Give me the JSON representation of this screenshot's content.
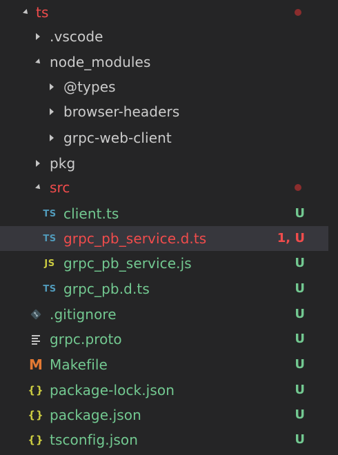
{
  "colors": {
    "background": "#252526",
    "selected_row": "#37373d",
    "default_text": "#cccccc",
    "untracked_green": "#73c991",
    "error_red": "#f14c4c",
    "ts_icon": "#519aba",
    "js_icon": "#cbcb41",
    "json_icon": "#cbcb41",
    "makefile_icon": "#e37933",
    "modified_dot": "#8b2d2d"
  },
  "tree": {
    "root": {
      "label": "ts",
      "twistie": "chevron-down-icon",
      "status": "modified-dot"
    },
    "vscode": {
      "label": ".vscode",
      "twistie": "chevron-right-icon"
    },
    "node_modules": {
      "label": "node_modules",
      "twistie": "chevron-down-icon"
    },
    "types": {
      "label": "@types",
      "twistie": "chevron-right-icon"
    },
    "browser_headers": {
      "label": "browser-headers",
      "twistie": "chevron-right-icon"
    },
    "grpc_web_client": {
      "label": "grpc-web-client",
      "twistie": "chevron-right-icon"
    },
    "pkg": {
      "label": "pkg",
      "twistie": "chevron-right-icon"
    },
    "src": {
      "label": "src",
      "twistie": "chevron-down-icon",
      "status": "modified-dot"
    },
    "client_ts": {
      "icon": "TS",
      "label": "client.ts",
      "decoration": "U"
    },
    "grpc_pb_service_d_ts": {
      "icon": "TS",
      "label": "grpc_pb_service.d.ts",
      "decoration": "1, U",
      "selected": true
    },
    "grpc_pb_service_js": {
      "icon": "JS",
      "label": "grpc_pb_service.js",
      "decoration": "U"
    },
    "grpc_pb_d_ts": {
      "icon": "TS",
      "label": "grpc_pb.d.ts",
      "decoration": "U"
    },
    "gitignore": {
      "icon": "git-diamond-icon",
      "label": ".gitignore",
      "decoration": "U"
    },
    "grpc_proto": {
      "icon": "text-lines-icon",
      "label": "grpc.proto",
      "decoration": "U"
    },
    "makefile": {
      "icon": "M",
      "label": "Makefile",
      "decoration": "U"
    },
    "package_lock_json": {
      "icon": "{}",
      "label": "package-lock.json",
      "decoration": "U"
    },
    "package_json": {
      "icon": "{}",
      "label": "package.json",
      "decoration": "U"
    },
    "tsconfig_json": {
      "icon": "{}",
      "label": "tsconfig.json",
      "decoration": "U"
    }
  }
}
